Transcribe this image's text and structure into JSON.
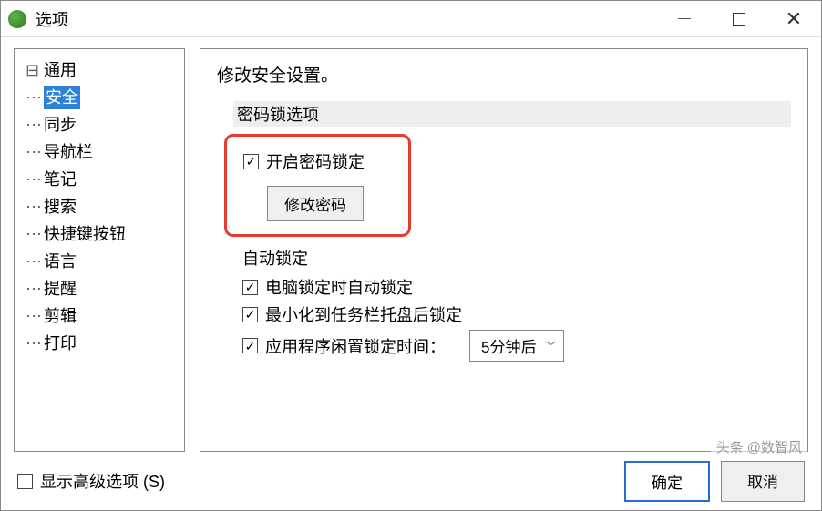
{
  "window": {
    "title": "选项"
  },
  "sidebar": {
    "items": [
      {
        "label": "通用"
      },
      {
        "label": "安全",
        "selected": true
      },
      {
        "label": "同步"
      },
      {
        "label": "导航栏"
      },
      {
        "label": "笔记"
      },
      {
        "label": "搜索"
      },
      {
        "label": "快捷键按钮"
      },
      {
        "label": "语言"
      },
      {
        "label": "提醒"
      },
      {
        "label": "剪辑"
      },
      {
        "label": "打印"
      }
    ]
  },
  "content": {
    "heading": "修改安全设置。",
    "pwd_group_label": "密码锁选项",
    "enable_pwd_lock": "开启密码锁定",
    "change_password_btn": "修改密码",
    "auto_lock_label": "自动锁定",
    "auto_lock_on_computer_lock": "电脑锁定时自动锁定",
    "auto_lock_on_minimize": "最小化到任务栏托盘后锁定",
    "auto_lock_idle_label": "应用程序闲置锁定时间：",
    "auto_lock_idle_value": "5分钟后"
  },
  "footer": {
    "show_advanced": "显示高级选项 (S)",
    "ok": "确定",
    "cancel": "取消"
  },
  "watermark": "头条 @数智风"
}
